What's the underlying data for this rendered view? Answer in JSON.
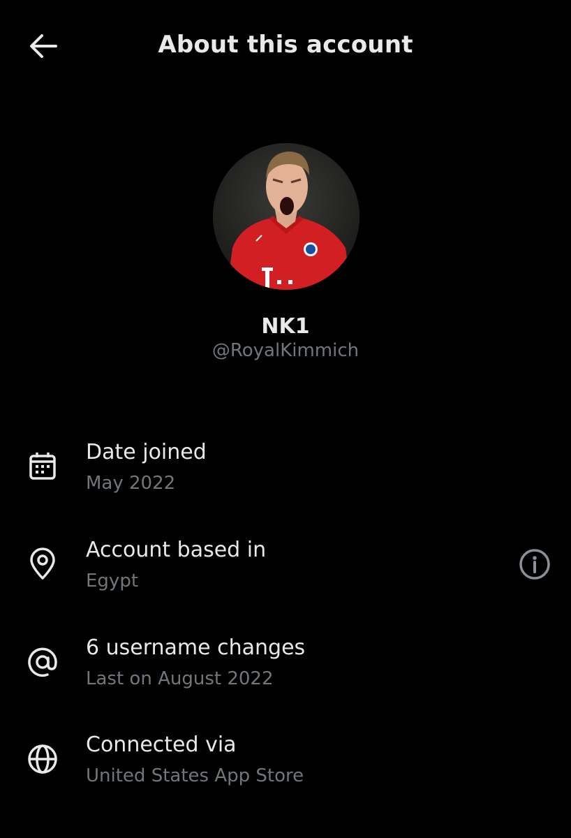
{
  "header": {
    "title": "About this account",
    "back_icon": "arrow-left-icon"
  },
  "profile": {
    "display_name": "NK1",
    "handle": "@RoyalKimmich",
    "avatar": "profile-photo"
  },
  "details": [
    {
      "icon": "calendar-icon",
      "title": "Date joined",
      "value": "May 2022"
    },
    {
      "icon": "location-pin-icon",
      "title": "Account based in",
      "value": "Egypt",
      "action_icon": "info-icon"
    },
    {
      "icon": "at-sign-icon",
      "title": "6 username changes",
      "value": "Last on August 2022"
    },
    {
      "icon": "globe-icon",
      "title": "Connected via",
      "value": "United States App Store"
    }
  ],
  "colors": {
    "background": "#000000",
    "primary_text": "#e7e9ea",
    "secondary_text": "#71767b"
  }
}
